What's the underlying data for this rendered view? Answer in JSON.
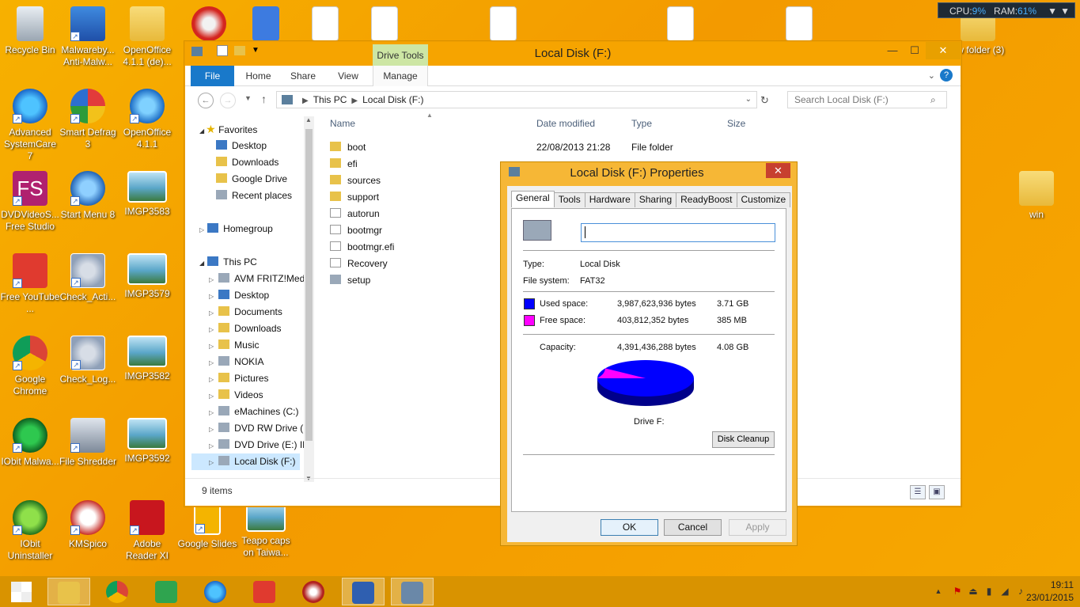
{
  "system_monitor": {
    "cpu_label": "CPU:",
    "cpu_value": "9%",
    "ram_label": "RAM:",
    "ram_value": "61%"
  },
  "desktop_icons": [
    {
      "label": "Recycle Bin"
    },
    {
      "label": "Malwareby... Anti-Malw..."
    },
    {
      "label": "OpenOffice 4.1.1 (de)..."
    },
    {
      "label": "Advanced SystemCare 7"
    },
    {
      "label": "Smart Defrag 3"
    },
    {
      "label": "OpenOffice 4.1.1"
    },
    {
      "label": "DVDVideoS... Free Studio"
    },
    {
      "label": "Start Menu 8"
    },
    {
      "label": "IMGP3583"
    },
    {
      "label": "Free YouTube ..."
    },
    {
      "label": "Check_Acti..."
    },
    {
      "label": "IMGP3579"
    },
    {
      "label": "Google Chrome"
    },
    {
      "label": "Check_Log..."
    },
    {
      "label": "IMGP3582"
    },
    {
      "label": "IObit Malwa..."
    },
    {
      "label": "File Shredder"
    },
    {
      "label": "IMGP3592"
    },
    {
      "label": "IObit Uninstaller"
    },
    {
      "label": "KMSpico"
    },
    {
      "label": "Adobe Reader XI"
    },
    {
      "label": "Google Slides"
    },
    {
      "label": "Teapo caps on Taiwa..."
    },
    {
      "label": "ew folder (3)"
    },
    {
      "label": "win"
    }
  ],
  "explorer": {
    "title": "Local Disk (F:)",
    "contextual_tab_group": "Drive Tools",
    "ribbon_tabs": [
      "File",
      "Home",
      "Share",
      "View",
      "Manage"
    ],
    "breadcrumb": [
      "This PC",
      "Local Disk (F:)"
    ],
    "search_placeholder": "Search Local Disk (F:)",
    "nav": {
      "favorites_header": "Favorites",
      "favorites": [
        "Desktop",
        "Downloads",
        "Google Drive",
        "Recent places"
      ],
      "homegroup": "Homegroup",
      "thispc_header": "This PC",
      "thispc": [
        "AVM FRITZ!Medi",
        "Desktop",
        "Documents",
        "Downloads",
        "Music",
        "NOKIA",
        "Pictures",
        "Videos",
        "eMachines (C:)",
        "DVD RW Drive (D",
        "DVD Drive (E:) IRI",
        "Local Disk (F:)"
      ]
    },
    "columns": [
      "Name",
      "Date modified",
      "Type",
      "Size"
    ],
    "files": [
      {
        "name": "boot",
        "date": "22/08/2013 21:28",
        "type": "File folder"
      },
      {
        "name": "efi",
        "date": "",
        "type": ""
      },
      {
        "name": "sources",
        "date": "",
        "type": ""
      },
      {
        "name": "support",
        "date": "",
        "type": ""
      },
      {
        "name": "autorun",
        "date": "",
        "type": ""
      },
      {
        "name": "bootmgr",
        "date": "",
        "type": ""
      },
      {
        "name": "bootmgr.efi",
        "date": "",
        "type": ""
      },
      {
        "name": "Recovery",
        "date": "",
        "type": ""
      },
      {
        "name": "setup",
        "date": "",
        "type": ""
      }
    ],
    "status": "9 items"
  },
  "properties": {
    "title": "Local Disk (F:) Properties",
    "tabs": [
      "General",
      "Tools",
      "Hardware",
      "Sharing",
      "ReadyBoost",
      "Customize"
    ],
    "volume_label_value": "",
    "type_label": "Type:",
    "type_value": "Local Disk",
    "fs_label": "File system:",
    "fs_value": "FAT32",
    "used_label": "Used space:",
    "used_bytes": "3,987,623,936 bytes",
    "used_size": "3.71 GB",
    "free_label": "Free space:",
    "free_bytes": "403,812,352 bytes",
    "free_size": "385 MB",
    "capacity_label": "Capacity:",
    "capacity_bytes": "4,391,436,288 bytes",
    "capacity_size": "4.08 GB",
    "drive_label": "Drive F:",
    "cleanup_button": "Disk Cleanup",
    "ok": "OK",
    "cancel": "Cancel",
    "apply": "Apply",
    "used_color": "#0000ff",
    "free_color": "#ff00ff",
    "used_fraction": 0.908
  },
  "taskbar": {
    "time": "19:11",
    "date": "23/01/2015"
  },
  "colors": {
    "accent": "#f6a400",
    "file_tab": "#1979ca",
    "taskbar": "#d99300"
  }
}
